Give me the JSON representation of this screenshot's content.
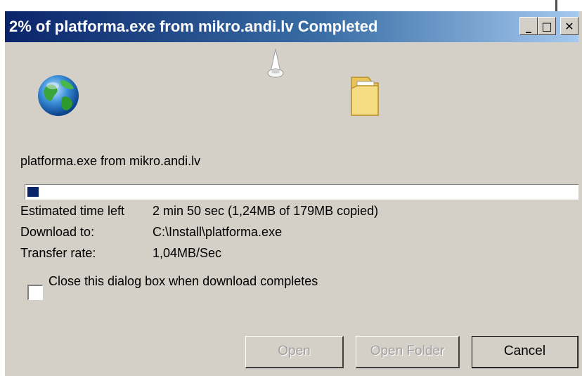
{
  "window": {
    "title": "2% of platforma.exe from mikro.andi.lv Completed",
    "controls": {
      "minimize": "_",
      "maximize": "□",
      "close": "✕"
    }
  },
  "icons": {
    "source": "globe-icon",
    "transfer": "cone-icon",
    "destination": "folder-icon"
  },
  "download": {
    "file_label": "platforma.exe from mikro.andi.lv",
    "progress_fraction": 0.02,
    "estimated_label": "Estimated time left",
    "estimated_value": "2 min 50 sec (1,24MB of 179MB copied)",
    "download_to_label": "Download to:",
    "download_to_value": "C:\\Install\\platforma.exe",
    "rate_label": "Transfer rate:",
    "rate_value": "1,04MB/Sec"
  },
  "options": {
    "close_when_done_label": "Close this dialog box when download completes",
    "close_when_done_checked": false
  },
  "buttons": {
    "open": "Open",
    "open_folder": "Open Folder",
    "cancel": "Cancel"
  },
  "colors": {
    "title_gradient_start": "#0a246a",
    "title_gradient_end": "#a6caf0",
    "face": "#d4d0c8",
    "progress": "#0a246a"
  }
}
